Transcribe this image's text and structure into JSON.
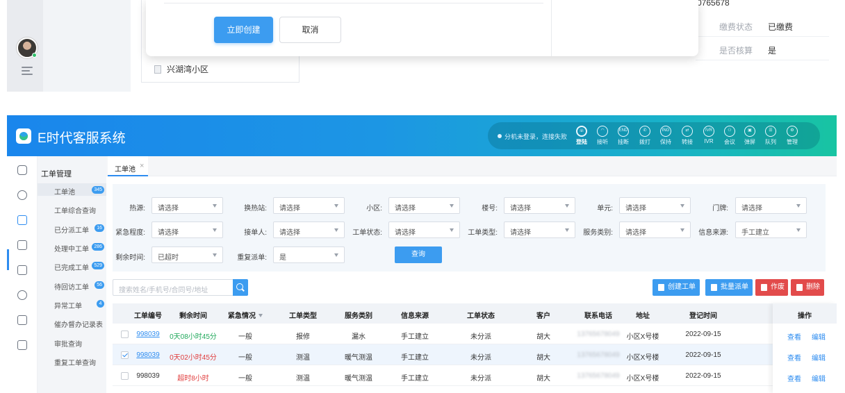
{
  "top_fragment": {
    "phone_partial": "0765678",
    "kv": [
      {
        "key": "缴费状态",
        "value": "已缴费"
      },
      {
        "key": "是否核算",
        "value": "是"
      }
    ],
    "tree_item": "兴湖湾小区",
    "modal": {
      "confirm_label": "立即创建",
      "cancel_label": "取消"
    }
  },
  "app": {
    "title": "E时代客服系统",
    "telephony": {
      "status": "分机未登录，连接失败",
      "buttons": [
        {
          "label": "登陆",
          "icon": "phone-icon",
          "glyph": "☏"
        },
        {
          "label": "接听",
          "icon": "headset-icon",
          "glyph": "◠"
        },
        {
          "label": "挂断",
          "icon": "end-call-icon",
          "glyph": "END"
        },
        {
          "label": "拨打",
          "icon": "dial-icon",
          "glyph": "✆"
        },
        {
          "label": "保持",
          "icon": "hold-icon",
          "glyph": "ING"
        },
        {
          "label": "转接",
          "icon": "transfer-icon",
          "glyph": "⇄"
        },
        {
          "label": "IVR",
          "icon": "ivr-icon",
          "glyph": "IVR"
        },
        {
          "label": "会议",
          "icon": "conference-icon",
          "glyph": "⚇"
        },
        {
          "label": "弹屏",
          "icon": "popup-icon",
          "glyph": "▣"
        },
        {
          "label": "队列",
          "icon": "queue-icon",
          "glyph": "☰"
        },
        {
          "label": "管理",
          "icon": "gear-icon",
          "glyph": "⚙"
        }
      ]
    },
    "side_icons": [
      "home-icon",
      "user-search-icon",
      "workorder-icon",
      "edit-list-icon",
      "bell-icon",
      "cloud-icon",
      "layers-icon",
      "settings-icon"
    ],
    "sub_nav": {
      "title": "工单管理",
      "items": [
        {
          "label": "工单池",
          "badge": "345"
        },
        {
          "label": "工单综合查询",
          "badge": ""
        },
        {
          "label": "已分派工单",
          "badge": "16"
        },
        {
          "label": "处理中工单",
          "badge": "286"
        },
        {
          "label": "已完成工单",
          "badge": "529"
        },
        {
          "label": "待回访工单",
          "badge": "56"
        },
        {
          "label": "异常工单",
          "badge": "4"
        },
        {
          "label": "催办督办记录表",
          "badge": ""
        },
        {
          "label": "审批查询",
          "badge": ""
        },
        {
          "label": "重复工单查询",
          "badge": ""
        }
      ]
    },
    "tab": {
      "label": "工单池",
      "close": "×"
    },
    "filters": [
      {
        "label": "热源:",
        "value": "请选择"
      },
      {
        "label": "换热站:",
        "value": "请选择"
      },
      {
        "label": "小区:",
        "value": "请选择"
      },
      {
        "label": "楼号:",
        "value": "请选择"
      },
      {
        "label": "单元:",
        "value": "请选择"
      },
      {
        "label": "门牌:",
        "value": "请选择"
      },
      {
        "label": "紧急程度:",
        "value": "请选择"
      },
      {
        "label": "接单人:",
        "value": "请选择"
      },
      {
        "label": "工单状态:",
        "value": "请选择"
      },
      {
        "label": "工单类型:",
        "value": "请选择"
      },
      {
        "label": "服务类别:",
        "value": "请选择"
      },
      {
        "label": "信息来源:",
        "value": "手工建立"
      },
      {
        "label": "剩余时间:",
        "value": "已超时"
      },
      {
        "label": "重复派单:",
        "value": "是"
      }
    ],
    "query_label": "查询",
    "search_placeholder": "搜索姓名/手机号/合同号/地址",
    "actions": {
      "create": "创建工单",
      "batch": "批量派单",
      "void": "作废",
      "delete": "删除"
    },
    "table": {
      "headers": [
        "工单编号",
        "剩余时间",
        "紧急情况",
        "工单类型",
        "服务类别",
        "信息来源",
        "工单状态",
        "客户",
        "联系电话",
        "地址",
        "登记时间",
        "操作"
      ],
      "rows": [
        {
          "checked": false,
          "id": "998039",
          "id_link": true,
          "remaining": "0天08小时45分",
          "remaining_color": "green",
          "urgency": "一般",
          "type": "报修",
          "service": "漏水",
          "source": "手工建立",
          "status": "未分派",
          "customer": "胡大",
          "phone": "13765678049",
          "address": "小区X号楼",
          "date": "2022-09-15",
          "view": "查看",
          "edit": "编辑"
        },
        {
          "checked": true,
          "id": "998039",
          "id_link": true,
          "remaining": "0天02小时45分",
          "remaining_color": "red",
          "urgency": "一般",
          "type": "测温",
          "service": "暖气测温",
          "source": "手工建立",
          "status": "未分派",
          "customer": "胡大",
          "phone": "13765678049",
          "address": "小区X号楼",
          "date": "2022-09-15",
          "view": "查看",
          "edit": "编辑"
        },
        {
          "checked": false,
          "id": "998039",
          "id_link": false,
          "remaining": "超时8小时",
          "remaining_color": "red",
          "urgency": "一般",
          "type": "测温",
          "service": "暖气测温",
          "source": "手工建立",
          "status": "未分派",
          "customer": "胡大",
          "phone": "13765678049",
          "address": "小区X号楼",
          "date": "2022-09-15",
          "view": "查看",
          "edit": "编辑"
        }
      ]
    }
  }
}
